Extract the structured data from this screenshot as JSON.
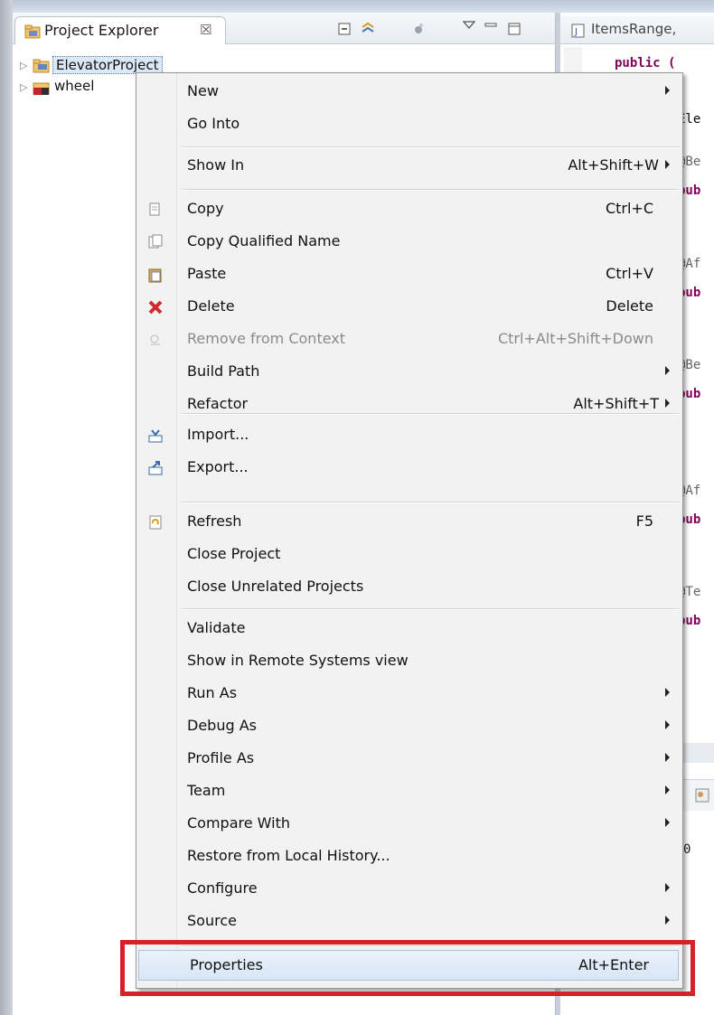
{
  "explorer": {
    "title": "Project Explorer",
    "close_glyph": "☒",
    "projects": [
      {
        "label": "ElevatorProject",
        "selected": true,
        "icon": "java-project-icon"
      },
      {
        "label": "wheel",
        "selected": false,
        "icon": "web-project-icon"
      }
    ],
    "toolbar_icons": [
      "collapse-all-icon",
      "link-with-editor-icon",
      "filter-icon",
      "view-menu-icon",
      "minimize-icon",
      "maximize-icon"
    ]
  },
  "editor": {
    "tab_title": "ItemsRange,",
    "code_lines": [
      {
        "text": "public (",
        "style": "kw"
      },
      {
        "text": "Ele",
        "style": "plain"
      },
      {
        "text": "@Be",
        "style": "ann"
      },
      {
        "text": "pub",
        "style": "kw"
      },
      {
        "text": "@Af",
        "style": "ann"
      },
      {
        "text": "pub",
        "style": "kw"
      },
      {
        "text": "@Be",
        "style": "ann"
      },
      {
        "text": "pub",
        "style": "kw"
      },
      {
        "text": "@Af",
        "style": "ann"
      },
      {
        "text": "pub",
        "style": "kw"
      },
      {
        "text": "@Te",
        "style": "ann"
      },
      {
        "text": "pub",
        "style": "kw"
      }
    ],
    "lower_value": "0"
  },
  "context_menu": {
    "items": [
      {
        "label": "New",
        "shortcut": "",
        "submenu": true,
        "icon": ""
      },
      {
        "label": "Go Into",
        "shortcut": "",
        "submenu": false,
        "icon": ""
      },
      {
        "label": "Show In",
        "shortcut": "Alt+Shift+W",
        "submenu": true,
        "icon": ""
      },
      {
        "label": "Copy",
        "shortcut": "Ctrl+C",
        "submenu": false,
        "icon": "copy-icon"
      },
      {
        "label": "Copy Qualified Name",
        "shortcut": "",
        "submenu": false,
        "icon": "copy-qualified-name-icon"
      },
      {
        "label": "Paste",
        "shortcut": "Ctrl+V",
        "submenu": false,
        "icon": "paste-icon"
      },
      {
        "label": "Delete",
        "shortcut": "Delete",
        "submenu": false,
        "icon": "delete-icon"
      },
      {
        "label": "Remove from Context",
        "shortcut": "Ctrl+Alt+Shift+Down",
        "submenu": false,
        "icon": "remove-from-context-icon",
        "disabled": true
      },
      {
        "label": "Build Path",
        "shortcut": "",
        "submenu": true,
        "icon": ""
      },
      {
        "label": "Refactor",
        "shortcut": "Alt+Shift+T",
        "submenu": true,
        "icon": ""
      },
      {
        "label": "Import...",
        "shortcut": "",
        "submenu": false,
        "icon": "import-icon"
      },
      {
        "label": "Export...",
        "shortcut": "",
        "submenu": false,
        "icon": "export-icon"
      },
      {
        "label": "Refresh",
        "shortcut": "F5",
        "submenu": false,
        "icon": "refresh-icon"
      },
      {
        "label": "Close Project",
        "shortcut": "",
        "submenu": false,
        "icon": ""
      },
      {
        "label": "Close Unrelated Projects",
        "shortcut": "",
        "submenu": false,
        "icon": ""
      },
      {
        "label": "Validate",
        "shortcut": "",
        "submenu": false,
        "icon": ""
      },
      {
        "label": "Show in Remote Systems view",
        "shortcut": "",
        "submenu": false,
        "icon": ""
      },
      {
        "label": "Run As",
        "shortcut": "",
        "submenu": true,
        "icon": ""
      },
      {
        "label": "Debug As",
        "shortcut": "",
        "submenu": true,
        "icon": ""
      },
      {
        "label": "Profile As",
        "shortcut": "",
        "submenu": true,
        "icon": ""
      },
      {
        "label": "Team",
        "shortcut": "",
        "submenu": true,
        "icon": ""
      },
      {
        "label": "Compare With",
        "shortcut": "",
        "submenu": true,
        "icon": ""
      },
      {
        "label": "Restore from Local History...",
        "shortcut": "",
        "submenu": false,
        "icon": ""
      },
      {
        "label": "Configure",
        "shortcut": "",
        "submenu": true,
        "icon": ""
      },
      {
        "label": "Source",
        "shortcut": "",
        "submenu": true,
        "icon": ""
      },
      {
        "label": "Properties",
        "shortcut": "Alt+Enter",
        "submenu": false,
        "icon": "",
        "highlighted": true
      }
    ]
  },
  "colors": {
    "highlight_box": "#d3222a",
    "menu_background": "#f2f2f2",
    "selection": "#dbe8f6",
    "keyword": "#7f0055"
  }
}
